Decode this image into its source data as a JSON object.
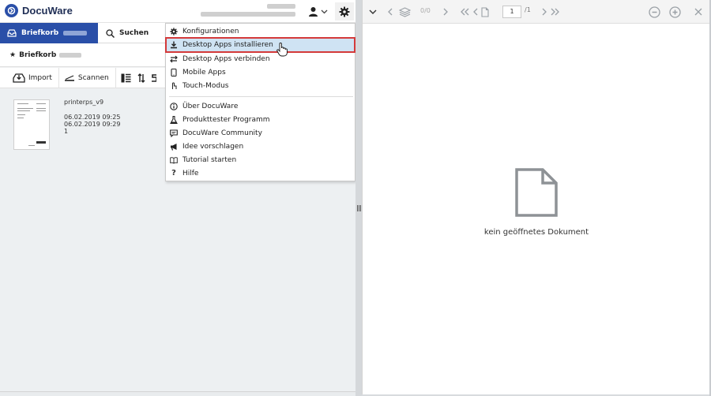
{
  "app": {
    "name": "DocuWare"
  },
  "header": {
    "user_line1": "████████",
    "user_line2": "████████ ████ ██████████"
  },
  "tabs": [
    {
      "label": "Briefkorb"
    },
    {
      "label": "Suchen"
    }
  ],
  "tray": {
    "label": "Briefkorb"
  },
  "toolbar": {
    "import_label": "Import",
    "scan_label": "Scannen"
  },
  "documents": [
    {
      "title": "printerps_v9",
      "line1": "06.02.2019 09:25",
      "line2": "06.02.2019 09:29",
      "line3": "1"
    }
  ],
  "menu": {
    "items": [
      {
        "label": "Konfigurationen",
        "icon": "gear-icon"
      },
      {
        "label": "Desktop Apps installieren",
        "icon": "download-icon"
      },
      {
        "label": "Desktop Apps verbinden",
        "icon": "link-arrows-icon"
      },
      {
        "label": "Mobile Apps",
        "icon": "phone-icon"
      },
      {
        "label": "Touch-Modus",
        "icon": "touch-icon"
      },
      {
        "label": "Über DocuWare",
        "icon": "info-icon"
      },
      {
        "label": "Produkttester Programm",
        "icon": "flask-icon"
      },
      {
        "label": "DocuWare Community",
        "icon": "chat-icon"
      },
      {
        "label": "Idee vorschlagen",
        "icon": "megaphone-icon"
      },
      {
        "label": "Tutorial starten",
        "icon": "book-icon"
      },
      {
        "label": "Hilfe",
        "icon": "question-icon"
      }
    ],
    "highlight_color": "#d43a3a"
  },
  "viewer": {
    "page_count": "0/0",
    "page_input": "1",
    "page_total": "/1",
    "empty_label": "kein geöffnetes Dokument"
  },
  "colors": {
    "brand": "#2a4fa8",
    "menu_hover": "#cfe3f3"
  }
}
